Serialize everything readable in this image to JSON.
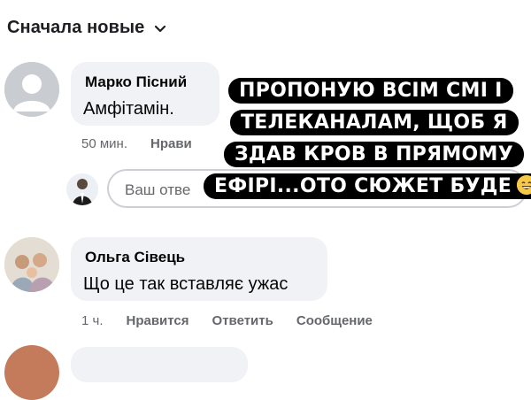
{
  "sort": {
    "label": "Сначала новые",
    "icon": "chevron-down-icon"
  },
  "comments": [
    {
      "author": "Марко Пісний",
      "text": "Амфітамін.",
      "time": "50 мин.",
      "like_label": "Нрави"
    },
    {
      "author": "Ольга Сівець",
      "text": "Що це так вставляє ужас",
      "time": "1 ч.",
      "like_label": "Нравится",
      "reply_label": "Ответить",
      "message_label": "Сообщение"
    }
  ],
  "reply": {
    "placeholder": "Ваш отве"
  },
  "overlay": {
    "lines": [
      "ПРОПОНУЮ ВСІМ СМІ І",
      "ТЕЛЕКАНАЛАМ, ЩОБ Я",
      "ЗДАВ КРОВ В ПРЯМОМУ",
      "ЕФІРІ...ОТО СЮЖЕТ БУДЕ"
    ],
    "emoji": "grinning-sweat-emoji-icon"
  },
  "colors": {
    "bubble": "#f0f2f5",
    "meta": "#65676b",
    "overlay_bg": "#000000"
  }
}
